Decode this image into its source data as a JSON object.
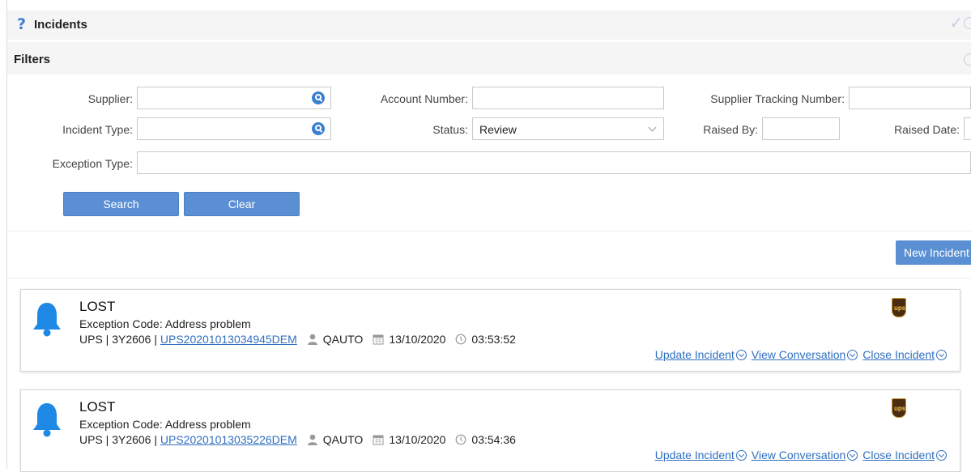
{
  "header": {
    "title": "Incidents"
  },
  "filters": {
    "title": "Filters",
    "supplier_label": "Supplier:",
    "account_number_label": "Account Number:",
    "supplier_tracking_label": "Supplier Tracking Number:",
    "incident_type_label": "Incident Type:",
    "status_label": "Status:",
    "status_value": "Review",
    "raised_by_label": "Raised By:",
    "raised_date_label": "Raised Date:",
    "exception_type_label": "Exception Type:",
    "search_label": "Search",
    "clear_label": "Clear"
  },
  "new_incident_label": "New Incident",
  "incidents": [
    {
      "title": "LOST",
      "exception": "Exception Code: Address problem",
      "meta_prefix": "UPS | 3Y2606 | ",
      "tracking": "UPS20201013034945DEM",
      "user": "QAUTO",
      "date": "13/10/2020",
      "time": "03:53:52",
      "update": "Update Incident",
      "view": "View Conversation",
      "close": "Close Incident"
    },
    {
      "title": "LOST",
      "exception": "Exception Code: Address problem",
      "meta_prefix": "UPS | 3Y2606 | ",
      "tracking": "UPS20201013035226DEM",
      "user": "QAUTO",
      "date": "13/10/2020",
      "time": "03:54:36",
      "update": "Update Incident",
      "view": "View Conversation",
      "close": "Close Incident"
    }
  ],
  "colors": {
    "accent": "#3b7fd1",
    "button": "#5a8fd3",
    "link": "#2f6fc0",
    "header_bg": "#f5f5f5"
  }
}
